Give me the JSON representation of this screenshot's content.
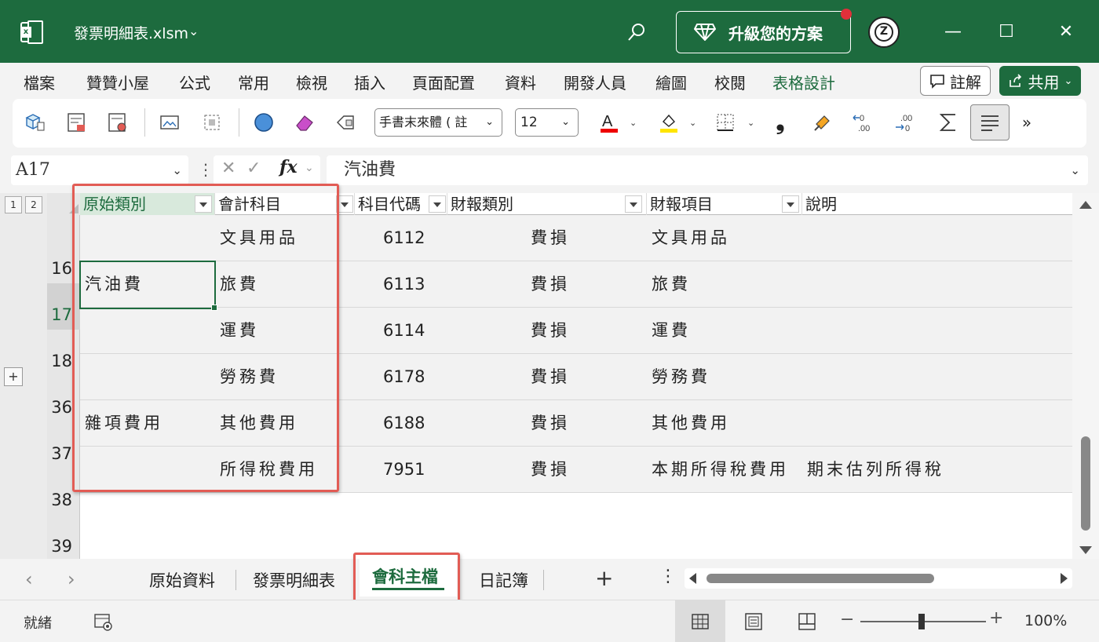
{
  "window": {
    "file_name": "發票明細表.xlsm",
    "upgrade_label": "升級您的方案",
    "avatar_initial": "Z",
    "minimize": "—",
    "maximize": "☐",
    "close": "✕"
  },
  "ribbon": {
    "tabs": [
      "檔案",
      "贊贊小屋",
      "公式",
      "常用",
      "檢視",
      "插入",
      "頁面配置",
      "資料",
      "開發人員",
      "繪圖",
      "校閱",
      "表格設計"
    ],
    "active_tab": "表格設計",
    "comment_label": "註解",
    "share_label": "共用",
    "font_name": "手書末來體 ( 註",
    "font_size": "12",
    "comma_style": "❟",
    "more": "»"
  },
  "formula_bar": {
    "name_box": "A17",
    "fx": "fx",
    "value": "汽油費"
  },
  "grid": {
    "outline_levels": [
      "1",
      "2"
    ],
    "expand_label": "+",
    "headers": [
      "原始類別",
      "會計科目",
      "科目代碼",
      "財報類別",
      "財報項目",
      "說明"
    ],
    "rows": [
      {
        "row": "16",
        "cells": [
          "",
          "文具用品",
          "6112",
          "費損",
          "文具用品",
          ""
        ]
      },
      {
        "row": "17",
        "cells": [
          "汽油費",
          "旅費",
          "6113",
          "費損",
          "旅費",
          ""
        ]
      },
      {
        "row": "18",
        "cells": [
          "",
          "運費",
          "6114",
          "費損",
          "運費",
          ""
        ]
      },
      {
        "row": "36",
        "cells": [
          "",
          "勞務費",
          "6178",
          "費損",
          "勞務費",
          ""
        ]
      },
      {
        "row": "37",
        "cells": [
          "雜項費用",
          "其他費用",
          "6188",
          "費損",
          "其他費用",
          ""
        ]
      },
      {
        "row": "38",
        "cells": [
          "",
          "所得稅費用",
          "7951",
          "費損",
          "本期所得稅費用",
          "期末估列所得稅"
        ]
      }
    ],
    "empty_row": "39",
    "selected_row": "17"
  },
  "sheets": {
    "tabs": [
      "原始資料",
      "發票明細表",
      "會科主檔",
      "日記簿"
    ],
    "active": "會科主檔",
    "add": "+",
    "more": "⋮"
  },
  "status": {
    "text": "就緒",
    "zoom_minus": "−",
    "zoom_plus": "+",
    "zoom": "100%"
  },
  "colors": {
    "brand_green": "#1d6b3e",
    "highlight_red": "#e25c55"
  }
}
